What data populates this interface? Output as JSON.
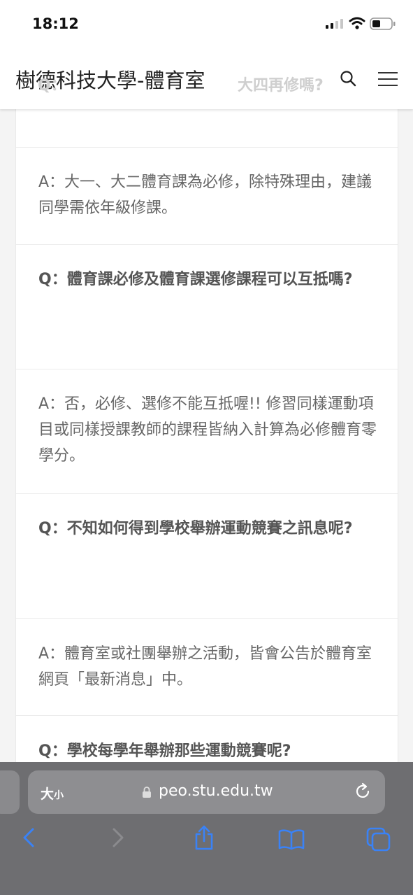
{
  "status_bar": {
    "time": "18:12"
  },
  "header": {
    "site_title": "樹德科技大學-體育室",
    "ghost_left": "Q：",
    "ghost_right": "大四再修嗎?"
  },
  "faq": {
    "answer_1": "A：大一、大二體育課為必修，除特殊理由，建議同學需依年級修課。",
    "question_2": "Q：體育課必修及體育課選修課程可以互抵嗎?",
    "answer_2": "A：否，必修、選修不能互抵喔!! 修習同樣運動項目或同樣授課教師的課程皆納入計算為必修體育零學分。",
    "question_3": "Q：不知如何得到學校舉辦運動競賽之訊息呢?",
    "answer_3": "A：體育室或社團舉辦之活動，皆會公告於體育室網頁「最新消息」中。",
    "question_4": "Q：學校每學年舉辦那些運動競賽呢?"
  },
  "browser": {
    "text_size_big": "大",
    "text_size_small": "小",
    "url_host": "peo.stu.edu.tw"
  },
  "icons": {
    "signal": "cellular-signal-icon",
    "wifi": "wifi-icon",
    "battery": "battery-icon",
    "search": "search-icon",
    "menu": "hamburger-menu-icon",
    "lock": "lock-icon",
    "reload": "reload-icon",
    "back": "back-chevron-icon",
    "forward": "forward-chevron-icon",
    "share": "share-icon",
    "bookmarks": "bookmarks-icon",
    "tabs": "tabs-icon"
  },
  "colors": {
    "toolbar": "#6e6e71",
    "toolbar_icon": "#3a82f6",
    "text": "#555555"
  }
}
